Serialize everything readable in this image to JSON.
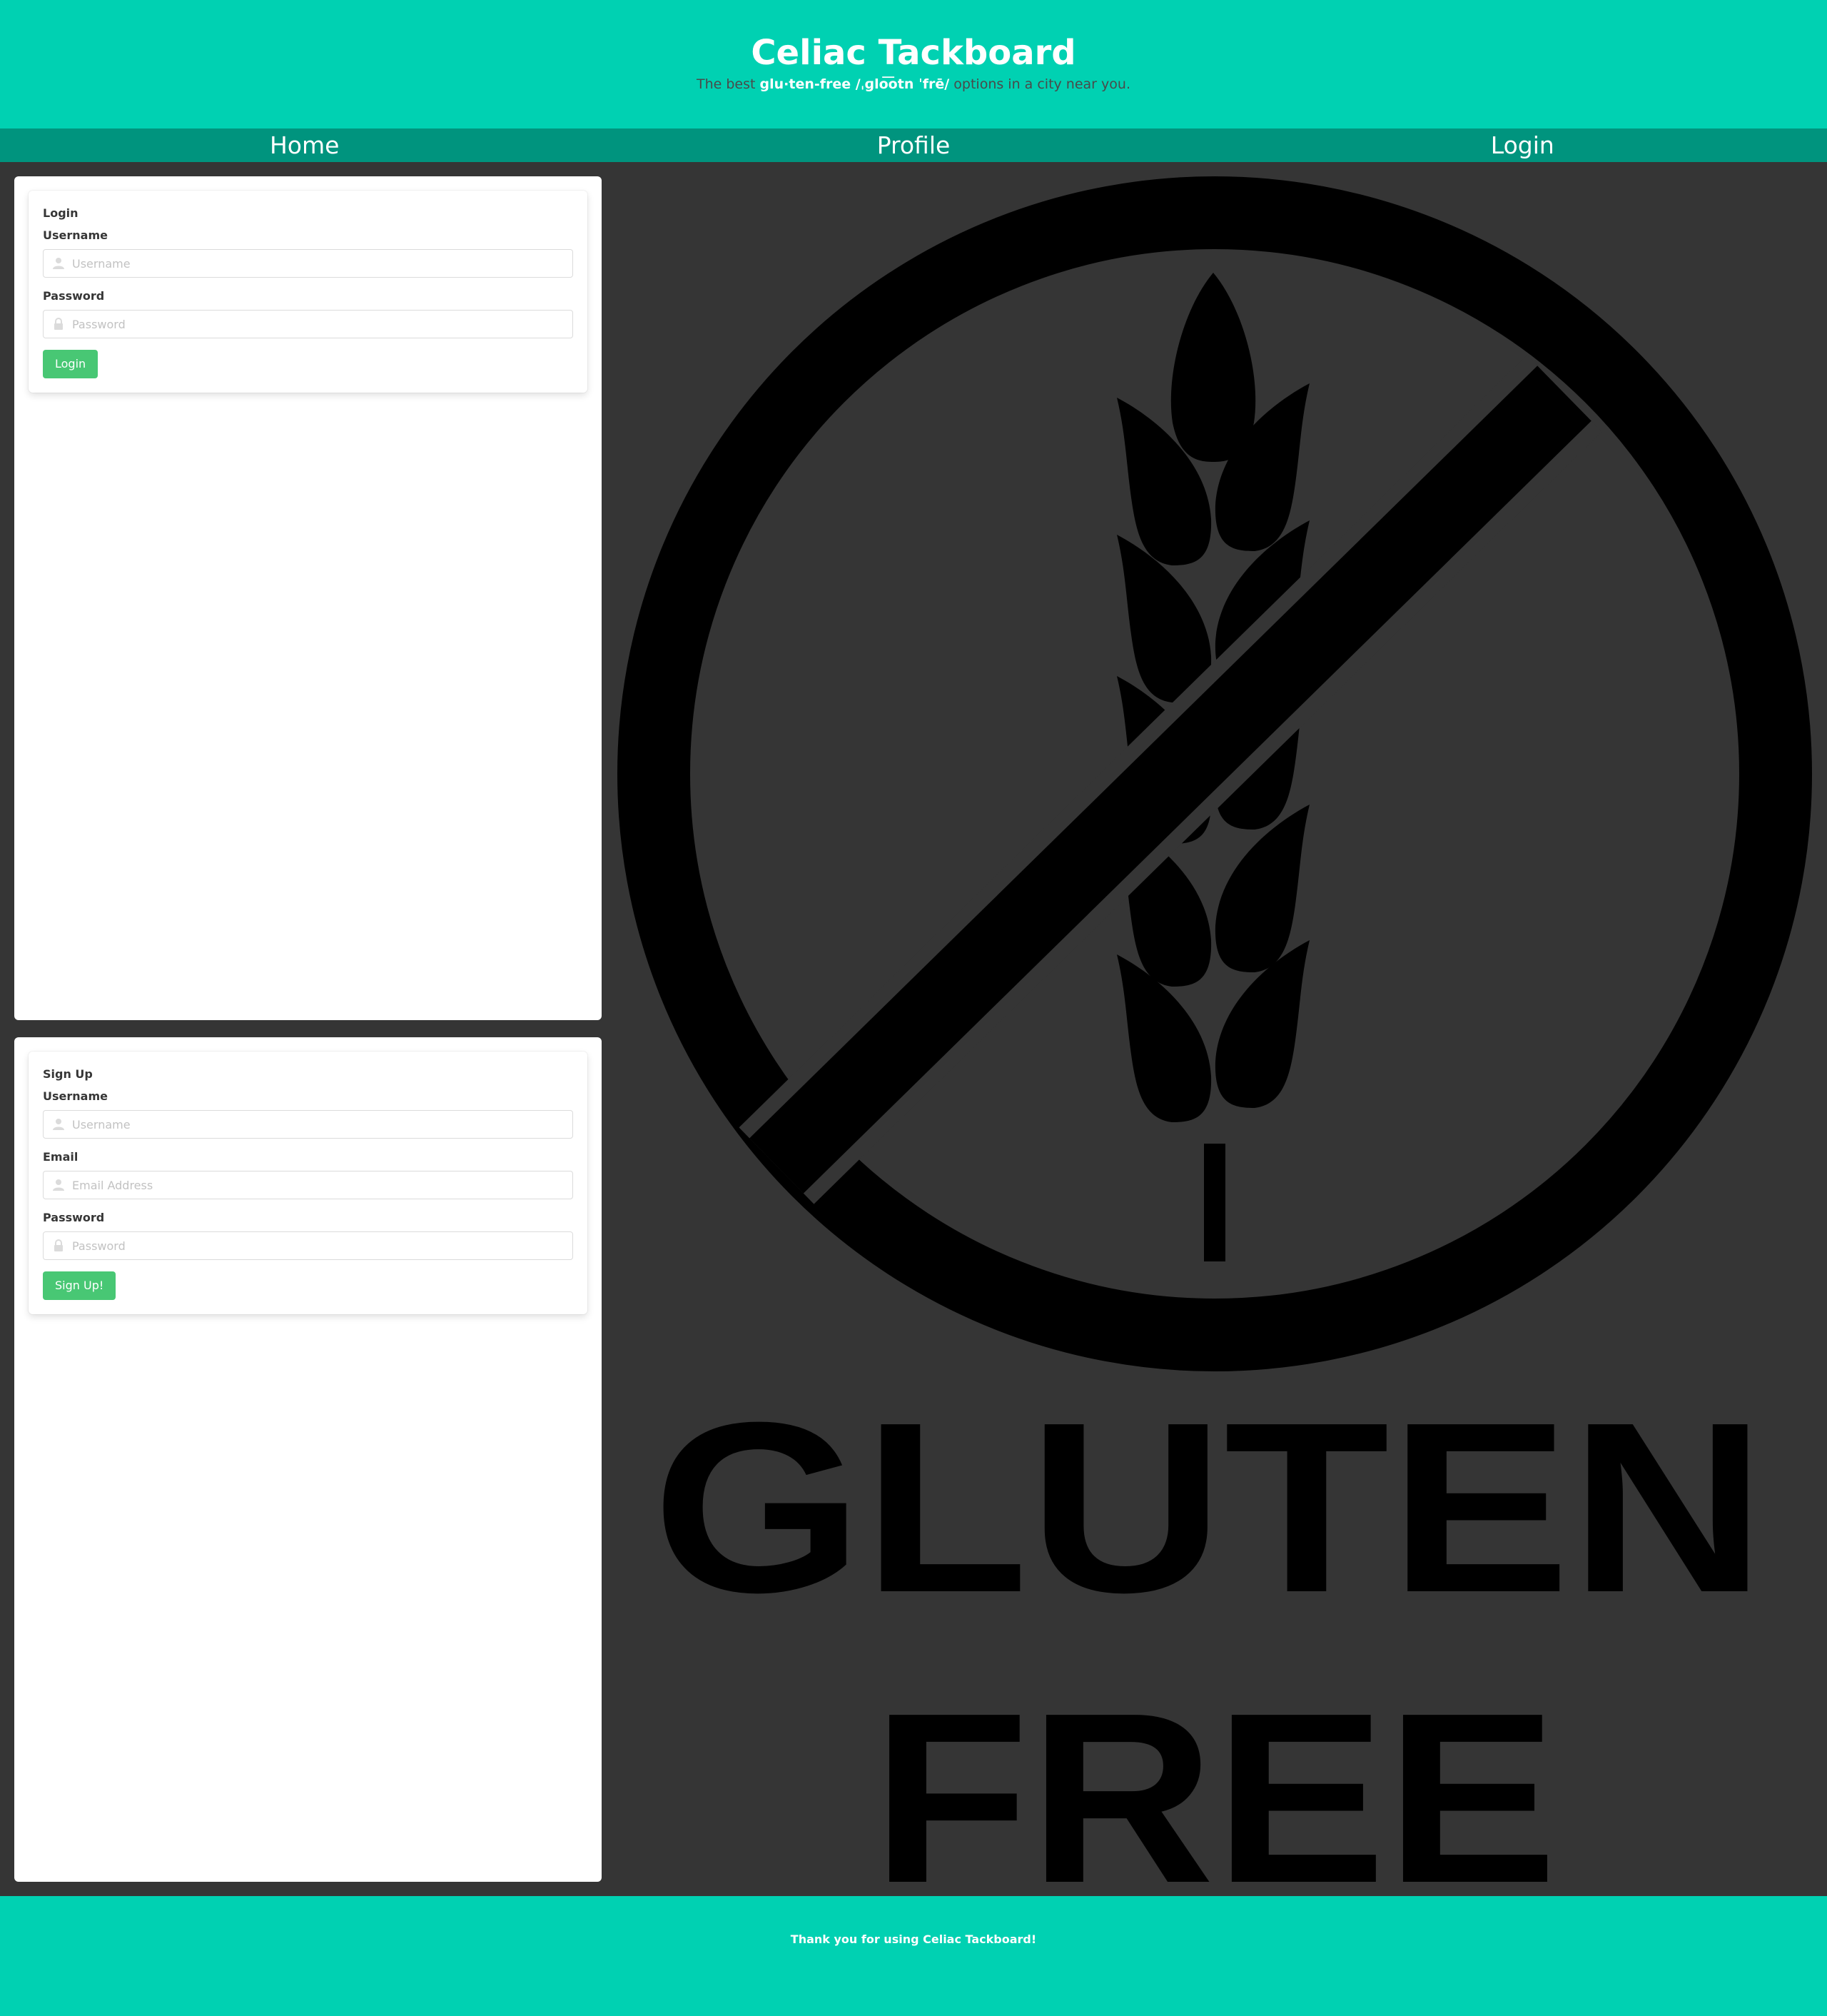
{
  "header": {
    "title": "Celiac Tackboard",
    "tagline_prefix": "The best ",
    "tagline_highlight": "glu·ten-free /ˌɡlo͞otn ˈfrē/",
    "tagline_suffix": " options in a city near you."
  },
  "nav": {
    "home": "Home",
    "profile": "Profile",
    "login": "Login"
  },
  "login_form": {
    "title": "Login",
    "username_label": "Username",
    "username_placeholder": "Username",
    "password_label": "Password",
    "password_placeholder": "Password",
    "submit_label": "Login"
  },
  "signup_form": {
    "title": "Sign Up",
    "username_label": "Username",
    "username_placeholder": "Username",
    "email_label": "Email",
    "email_placeholder": "Email Address",
    "password_label": "Password",
    "password_placeholder": "Password",
    "submit_label": "Sign Up!"
  },
  "logo": {
    "line1": "GLUTEN",
    "line2": "FREE",
    "icon": "no-wheat-icon"
  },
  "footer": {
    "text": "Thank you for using Celiac Tackboard!"
  },
  "colors": {
    "brand": "#00d1b2",
    "nav": "#00947e",
    "button": "#48c774",
    "background": "#353535"
  }
}
